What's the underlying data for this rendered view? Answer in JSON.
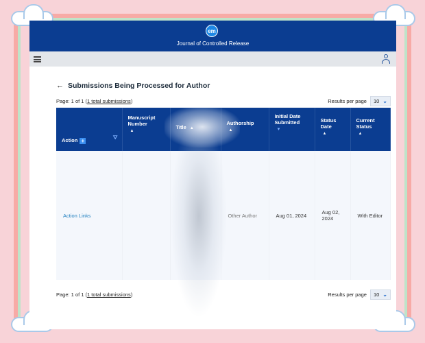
{
  "header": {
    "logo_text": "em",
    "journal_title": "Journal of Controlled Release"
  },
  "page": {
    "back_symbol": "←",
    "title": "Submissions Being Processed for Author"
  },
  "pager_top": {
    "prefix": "Page: 1 of 1 (",
    "link": "1 total submissions",
    "suffix": ")",
    "results_label": "Results per page",
    "results_value": "10"
  },
  "pager_bottom": {
    "prefix": "Page: 1 of 1 (",
    "link": "1 total submissions",
    "suffix": ")",
    "results_label": "Results per page",
    "results_value": "10"
  },
  "table": {
    "headers": {
      "action": "Action",
      "manuscript_number": "Manuscript Number",
      "title": "Title",
      "authorship": "Authorship",
      "initial_date": "Initial Date Submitted",
      "status_date": "Status Date",
      "current_status": "Current Status"
    },
    "rows": [
      {
        "action": "Action Links",
        "manuscript_number": "",
        "title": "",
        "authorship": "Other Author",
        "initial_date": "Aug 01, 2024",
        "status_date": "Aug 02, 2024",
        "current_status": "With Editor"
      }
    ]
  },
  "icons": {
    "plus": "+",
    "filter": "filter-clear-icon",
    "chevron": "chevron-down-icon",
    "menu": "hamburger-icon",
    "user": "user-icon"
  },
  "colors": {
    "header_blue": "#0b3d91",
    "link_blue": "#1f7fbf"
  }
}
